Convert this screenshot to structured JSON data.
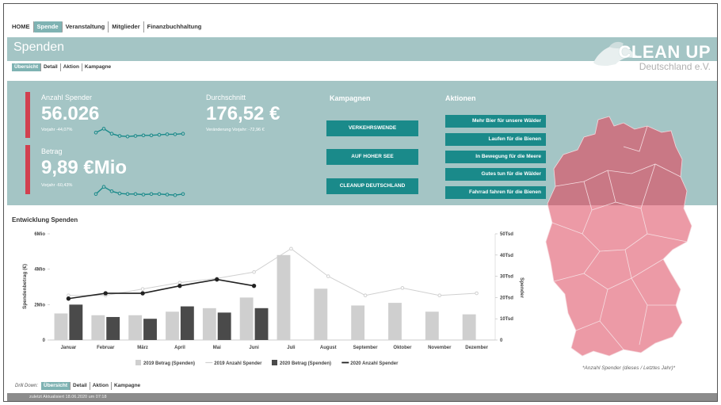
{
  "topnav": [
    "HOME",
    "Spende",
    "Veranstaltung",
    "Mitglieder",
    "Finanzbuchhaltung"
  ],
  "topnav_active": 1,
  "header": {
    "title": "Spenden",
    "logo_text": "CLEAN UP",
    "logo_sub": "Deutschland e.V."
  },
  "subnav": [
    "Übersicht",
    "Detail",
    "Aktion",
    "Kampagne"
  ],
  "kpis": {
    "anzahl": {
      "label": "Anzahl Spender",
      "value": "56.026",
      "note": "Vorjahr -44,07%"
    },
    "betrag": {
      "label": "Betrag",
      "value": "9,89 €Mio",
      "note": "Vorjahr -60,43%"
    },
    "durchschnitt": {
      "label": "Durchschnitt",
      "value": "176,52 €",
      "note": "Veränderung Vorjahr: -72,96 €"
    }
  },
  "sparklines": {
    "anzahl": [
      0.55,
      0.9,
      0.45,
      0.25,
      0.2,
      0.25,
      0.3,
      0.3,
      0.35,
      0.4,
      0.4,
      0.45
    ],
    "betrag": [
      0.3,
      0.95,
      0.55,
      0.35,
      0.3,
      0.3,
      0.25,
      0.3,
      0.3,
      0.25,
      0.2,
      0.3
    ]
  },
  "kampagnen": {
    "title": "Kampagnen",
    "items": [
      "VERKEHRSWENDE",
      "AUF HOHER SEE",
      "CLEANUP DEUTSCHLAND"
    ]
  },
  "aktionen": {
    "title": "Aktionen",
    "items": [
      "Mehr Bier für unsere Wälder",
      "Laufen für die Bienen",
      "In Bewegung für die Meere",
      "Gutes tun für die Wälder",
      "Fahrrad fahren für die Bienen"
    ]
  },
  "chart": {
    "title": "Entwicklung Spenden"
  },
  "chart_data": {
    "type": "bar",
    "categories": [
      "Januar",
      "Februar",
      "März",
      "April",
      "Mai",
      "Juni",
      "Juli",
      "August",
      "September",
      "Oktober",
      "November",
      "Dezember"
    ],
    "series": [
      {
        "name": "2019 Betrag (Spenden)",
        "kind": "bar",
        "axis": "left",
        "color": "#cfcfcf",
        "values": [
          1.5,
          1.4,
          1.4,
          1.6,
          1.8,
          2.4,
          4.8,
          2.9,
          1.95,
          2.1,
          1.6,
          1.45
        ]
      },
      {
        "name": "2020 Betrag (Spenden)",
        "kind": "bar",
        "axis": "left",
        "color": "#4a4a4a",
        "values": [
          2.0,
          1.3,
          1.2,
          1.9,
          1.55,
          1.8,
          null,
          null,
          null,
          null,
          null,
          null
        ]
      },
      {
        "name": "2019 Anzahl Spender",
        "kind": "line",
        "axis": "right",
        "color": "#d0d0d0",
        "values": [
          21,
          21,
          24,
          27,
          29,
          32,
          43,
          30,
          21,
          24.5,
          21,
          22
        ]
      },
      {
        "name": "2020 Anzahl Spender",
        "kind": "line",
        "axis": "right",
        "color": "#222222",
        "values": [
          19.5,
          22,
          22,
          25.5,
          28.5,
          25.5,
          null,
          null,
          null,
          null,
          null,
          null
        ]
      }
    ],
    "left_axis": {
      "label": "Spendenbetrag (€)",
      "ticks": [
        "0",
        "2Mio",
        "4Mio",
        "6Mio"
      ],
      "ylim": [
        0,
        6
      ]
    },
    "right_axis": {
      "label": "Spender",
      "ticks": [
        "0",
        "10Tsd",
        "20Tsd",
        "30Tsd",
        "40Tsd",
        "50Tsd"
      ],
      "ylim": [
        0,
        50
      ]
    },
    "legend": "bottom"
  },
  "map_caption": "*Anzahl Spender (dieses / Letztes Jahr)*",
  "drill": {
    "label": "Drill Down:",
    "items": [
      "Übersicht",
      "Detail",
      "Aktion",
      "Kampagne"
    ]
  },
  "footer": "zuletzt Aktualisiert 18.06.2020 um 07:18",
  "colors": {
    "panel": "#a4c5c5",
    "button": "#1a8a8a",
    "kpi_bar": "#d1404f",
    "map_top": "#c97885",
    "map_bottom": "#ec9aa6",
    "footer": "#8c8c8c"
  }
}
